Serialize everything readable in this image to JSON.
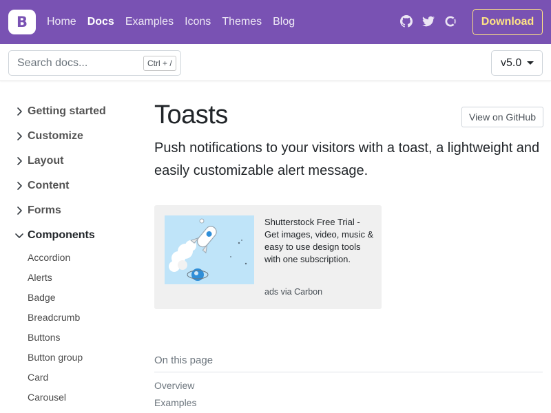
{
  "navbar": {
    "brand_letter": "B",
    "links": [
      {
        "label": "Home"
      },
      {
        "label": "Docs",
        "active": true
      },
      {
        "label": "Examples"
      },
      {
        "label": "Icons"
      },
      {
        "label": "Themes"
      },
      {
        "label": "Blog"
      }
    ],
    "icons": [
      "github-icon",
      "twitter-icon",
      "opencollective-icon"
    ],
    "download_label": "Download",
    "colors": {
      "background": "#7952b3",
      "download_accent": "#ffe484"
    }
  },
  "subbar": {
    "search_placeholder": "Search docs...",
    "search_shortcut": "Ctrl + /",
    "version": "v5.0"
  },
  "sidebar": {
    "sections": [
      {
        "label": "Getting started",
        "expanded": false
      },
      {
        "label": "Customize",
        "expanded": false
      },
      {
        "label": "Layout",
        "expanded": false
      },
      {
        "label": "Content",
        "expanded": false
      },
      {
        "label": "Forms",
        "expanded": false
      },
      {
        "label": "Components",
        "expanded": true
      }
    ],
    "component_items": [
      "Accordion",
      "Alerts",
      "Badge",
      "Breadcrumb",
      "Buttons",
      "Button group",
      "Card",
      "Carousel"
    ]
  },
  "main": {
    "title": "Toasts",
    "github_button": "View on GitHub",
    "lead": "Push notifications to your visitors with a toast, a lightweight and easily customizable alert message."
  },
  "ad": {
    "text": "Shutterstock Free Trial - Get images, video, music & easy to use design tools with one subscription.",
    "poweredby": "ads via Carbon"
  },
  "toc": {
    "title": "On this page",
    "links": [
      "Overview",
      "Examples"
    ]
  }
}
